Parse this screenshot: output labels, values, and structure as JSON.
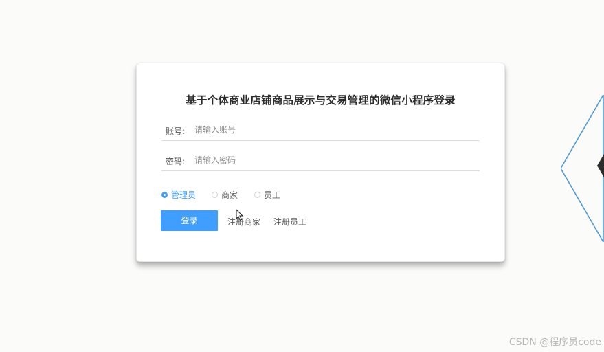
{
  "form": {
    "title": "基于个体商业店铺商品展示与交易管理的微信小程序登录",
    "account_label": "账号:",
    "account_placeholder": "请输入账号",
    "password_label": "密码:",
    "password_placeholder": "请输入密码",
    "roles": [
      {
        "label": "管理员",
        "checked": true
      },
      {
        "label": "商家",
        "checked": false
      },
      {
        "label": "员工",
        "checked": false
      }
    ],
    "login_button": "登录",
    "register_merchant": "注册商家",
    "register_staff": "注册员工"
  },
  "watermark": "CSDN @程序员code",
  "colors": {
    "accent": "#409eff",
    "background": "#fbfbfa",
    "deco_line": "#4f9ad6"
  },
  "icons": [
    "radio-icon",
    "mouse-cursor-icon",
    "diamond-decoration"
  ]
}
